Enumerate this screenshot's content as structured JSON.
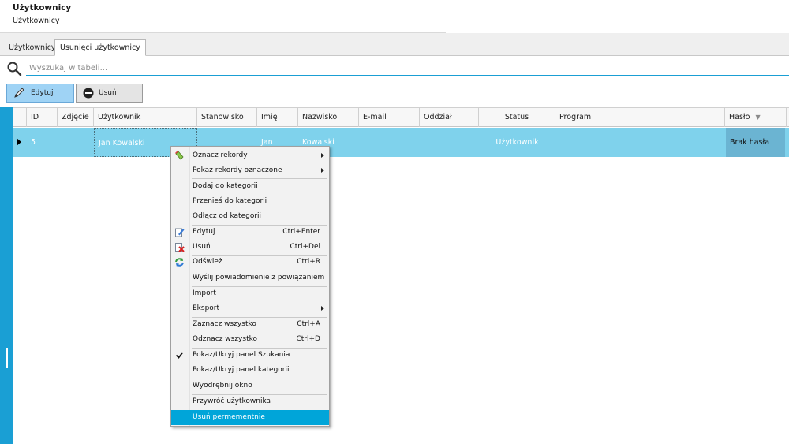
{
  "page": {
    "title": "Użytkownicy",
    "subtitle": "Użytkownicy"
  },
  "tabs": [
    {
      "label": "Użytkownicy",
      "active": false
    },
    {
      "label": "Usunięci użytkownicy",
      "active": true
    }
  ],
  "search": {
    "placeholder": "Wyszukaj w tabeli..."
  },
  "toolbar": {
    "edit_label": "Edytuj",
    "delete_label": "Usuń"
  },
  "table": {
    "columns": [
      "ID",
      "Zdjęcie",
      "Użytkownik",
      "Stanowisko",
      "Imię",
      "Nazwisko",
      "E-mail",
      "Oddział",
      "Status",
      "Program",
      "Hasło"
    ],
    "sort_indicator": "▼",
    "rows": [
      {
        "id": "5",
        "zdjecie": "",
        "uzytkownik": "Jan Kowalski",
        "stanowisko": "",
        "imie": "Jan",
        "nazwisko": "Kowalski",
        "email": "",
        "oddzial": "",
        "status": "Użytkownik",
        "program": "",
        "haslo": "Brak hasła"
      }
    ]
  },
  "context_menu": {
    "items": [
      {
        "label": "Oznacz rekordy",
        "submenu": true,
        "icon": "mark-records-icon"
      },
      {
        "label": "Pokaż rekordy oznaczone",
        "submenu": true
      },
      {
        "label": "Dodaj do kategorii"
      },
      {
        "label": "Przenieś do kategorii"
      },
      {
        "label": "Odłącz od kategorii"
      },
      {
        "label": "Edytuj",
        "shortcut": "Ctrl+Enter",
        "icon": "edit-icon"
      },
      {
        "label": "Usuń",
        "shortcut": "Ctrl+Del",
        "icon": "delete-icon"
      },
      {
        "label": "Odśwież",
        "shortcut": "Ctrl+R",
        "icon": "refresh-icon"
      },
      {
        "label": "Wyślij powiadomienie z powiązaniem"
      },
      {
        "label": "Import"
      },
      {
        "label": "Eksport",
        "submenu": true
      },
      {
        "label": "Zaznacz wszystko",
        "shortcut": "Ctrl+A"
      },
      {
        "label": "Odznacz wszystko",
        "shortcut": "Ctrl+D"
      },
      {
        "label": "Pokaż/Ukryj panel Szukania",
        "checked": true
      },
      {
        "label": "Pokaż/Ukryj panel kategorii"
      },
      {
        "label": "Wyodrębnij okno"
      },
      {
        "label": "Przywróć użytkownika"
      },
      {
        "label": "Usuń permementnie",
        "highlighted": true
      }
    ]
  },
  "colors": {
    "accent": "#1a9fd4",
    "row_selected": "#7fd2ec",
    "menu_highlight": "#00a5d9"
  }
}
